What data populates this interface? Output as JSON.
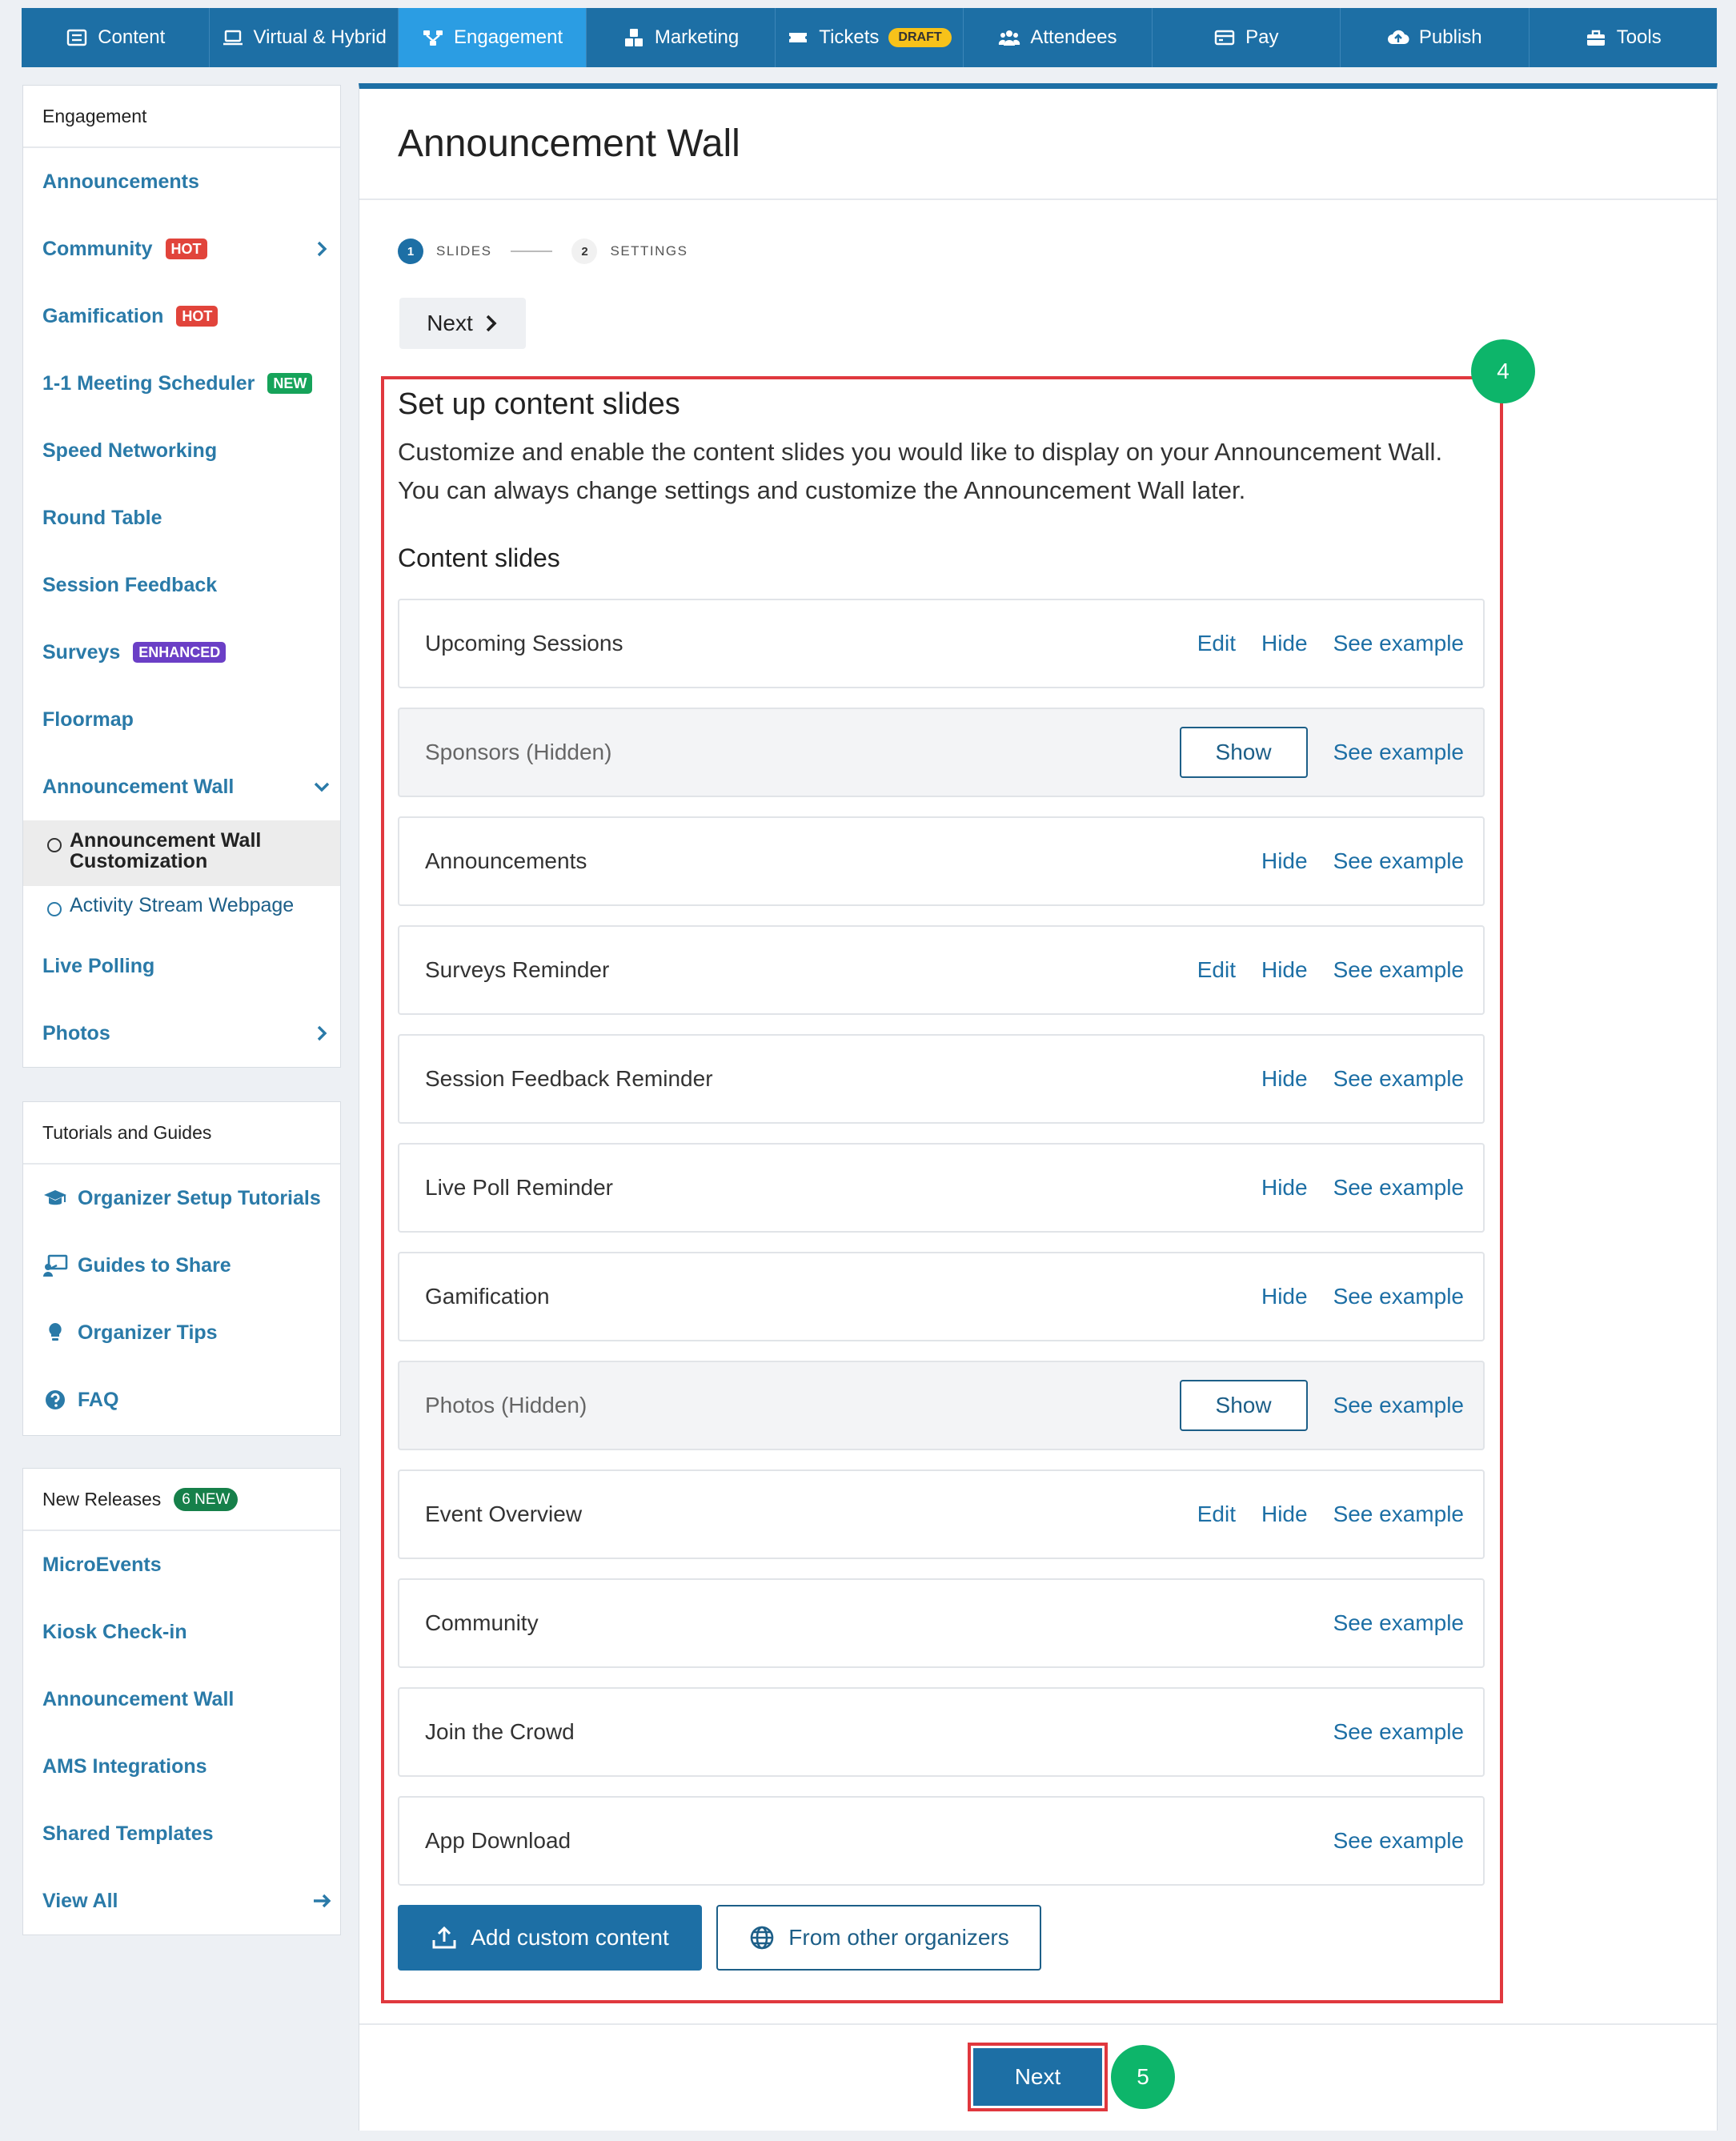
{
  "nav": {
    "tabs": [
      {
        "label": "Content",
        "icon": "list-icon"
      },
      {
        "label": "Virtual & Hybrid",
        "icon": "laptop-icon"
      },
      {
        "label": "Engagement",
        "icon": "share-nodes-icon",
        "active": true
      },
      {
        "label": "Marketing",
        "icon": "cubes-icon"
      },
      {
        "label": "Tickets",
        "icon": "ticket-icon",
        "badge": "DRAFT"
      },
      {
        "label": "Attendees",
        "icon": "users-icon"
      },
      {
        "label": "Pay",
        "icon": "credit-card-icon"
      },
      {
        "label": "Publish",
        "icon": "cloud-upload-icon"
      },
      {
        "label": "Tools",
        "icon": "toolbox-icon"
      }
    ]
  },
  "sidebar": {
    "engagement": {
      "header": "Engagement",
      "items": [
        {
          "label": "Announcements"
        },
        {
          "label": "Community",
          "badge": "HOT"
        },
        {
          "label": "Gamification",
          "badge": "HOT"
        },
        {
          "label": "1-1 Meeting Scheduler",
          "badge": "NEW"
        },
        {
          "label": "Speed Networking"
        },
        {
          "label": "Round Table"
        },
        {
          "label": "Session Feedback"
        },
        {
          "label": "Surveys",
          "badge": "ENHANCED"
        },
        {
          "label": "Floormap"
        },
        {
          "label": "Announcement Wall"
        },
        {
          "label": "Live Polling"
        },
        {
          "label": "Photos"
        }
      ],
      "sub_items": [
        {
          "label": "Announcement Wall Customization"
        },
        {
          "label": "Activity Stream Webpage"
        }
      ]
    },
    "tutorials": {
      "header": "Tutorials and Guides",
      "items": [
        {
          "label": "Organizer Setup Tutorials",
          "icon": "graduation-cap-icon"
        },
        {
          "label": "Guides to Share",
          "icon": "presentation-icon"
        },
        {
          "label": "Organizer Tips",
          "icon": "lightbulb-icon"
        },
        {
          "label": "FAQ",
          "icon": "question-circle-icon"
        }
      ]
    },
    "releases": {
      "header": "New Releases",
      "badge": "6 NEW",
      "items": [
        {
          "label": "MicroEvents"
        },
        {
          "label": "Kiosk Check-in"
        },
        {
          "label": "Announcement Wall"
        },
        {
          "label": "AMS Integrations"
        },
        {
          "label": "Shared Templates"
        },
        {
          "label": "View All"
        }
      ]
    }
  },
  "main": {
    "title": "Announcement Wall",
    "steps": [
      {
        "num": "1",
        "label": "SLIDES"
      },
      {
        "num": "2",
        "label": "SETTINGS"
      }
    ],
    "next_label": "Next",
    "section_title": "Set up content slides",
    "description": "Customize and enable the content slides you would like to display on your Announcement Wall. You can always change settings and customize the Announcement Wall later.",
    "slides_heading": "Content slides",
    "slides": [
      {
        "name": "Upcoming Sessions",
        "edit": "Edit",
        "hide": "Hide",
        "example": "See example"
      },
      {
        "name": "Sponsors (Hidden)",
        "show": "Show",
        "example": "See example",
        "hidden": true
      },
      {
        "name": "Announcements",
        "hide": "Hide",
        "example": "See example"
      },
      {
        "name": "Surveys Reminder",
        "edit": "Edit",
        "hide": "Hide",
        "example": "See example"
      },
      {
        "name": "Session Feedback Reminder",
        "hide": "Hide",
        "example": "See example"
      },
      {
        "name": "Live Poll Reminder",
        "hide": "Hide",
        "example": "See example"
      },
      {
        "name": "Gamification",
        "hide": "Hide",
        "example": "See example"
      },
      {
        "name": "Photos (Hidden)",
        "show": "Show",
        "example": "See example",
        "hidden": true
      },
      {
        "name": "Event Overview",
        "edit": "Edit",
        "hide": "Hide",
        "example": "See example"
      },
      {
        "name": "Community",
        "example": "See example"
      },
      {
        "name": "Join the Crowd",
        "example": "See example"
      },
      {
        "name": "App Download",
        "example": "See example"
      }
    ],
    "add_custom_label": "Add custom content",
    "from_other_label": "From other organizers",
    "bottom_next_label": "Next"
  },
  "annotations": {
    "step4": "4",
    "step5": "5"
  },
  "colors": {
    "nav": "#1d6fa5",
    "nav_active": "#2b9de3",
    "link": "#2a7aa8",
    "highlight": "#e0383e",
    "marker": "#0db56a"
  }
}
